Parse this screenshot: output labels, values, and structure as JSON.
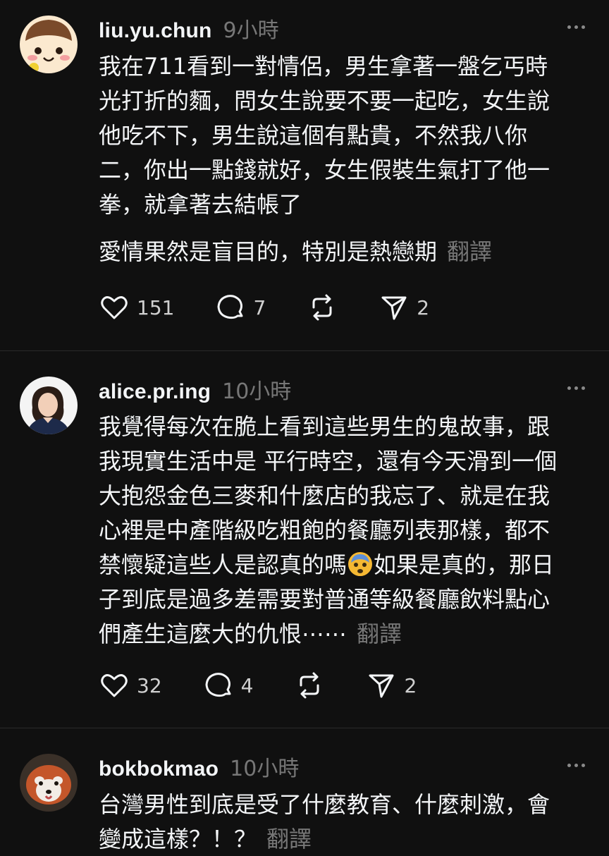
{
  "posts": [
    {
      "username": "liu.yu.chun",
      "time": "9小時",
      "avatar": "cartoon-face-avatar",
      "lines": [
        "我在711看到一對情侶，男生拿著一盤乞丐時",
        "光打折的麵，問女生說要不要一起吃，女生說",
        "他吃不下，男生說這個有點貴，不然我八你",
        "二，你出一點錢就好，女生假裝生氣打了他一",
        "拳，就拿著去結帳了"
      ],
      "last_line": "愛情果然是盲目的，特別是熱戀期",
      "translate": "翻譯",
      "likes": "151",
      "comments": "7",
      "shares": "2"
    },
    {
      "username": "alice.pr.ing",
      "time": "10小時",
      "avatar": "woman-photo-avatar",
      "lines": [
        "我覺得每次在脆上看到這些男生的鬼故事，跟",
        "我現實生活中是 平行時空，還有今天滑到一個",
        "大抱怨金色三麥和什麼店的我忘了、就是在我",
        "心裡是中產階級吃粗飽的餐廳列表那樣，都不"
      ],
      "line5_before": "禁懷疑這些人是認真的嗎",
      "line5_after": "如果是真的，那日",
      "line6": "子到底是過多差需要對普通等級餐廳飲料點心",
      "last_line": "們產生這麼大的仇恨⋯⋯",
      "translate": "翻譯",
      "likes": "32",
      "comments": "4",
      "shares": "2"
    },
    {
      "username": "bokbokmao",
      "time": "10小時",
      "avatar": "red-panda-avatar",
      "lines": [
        "台灣男性到底是受了什麼教育、什麼刺激，會"
      ],
      "last_line": "變成這樣？！？",
      "translate": "翻譯"
    }
  ],
  "colors": {
    "background": "#101010",
    "text": "#f3f5f7",
    "muted": "#777777",
    "divider": "#2a2a2a"
  },
  "icons": [
    "heart-icon",
    "comment-icon",
    "repost-icon",
    "send-icon",
    "more-icon"
  ]
}
